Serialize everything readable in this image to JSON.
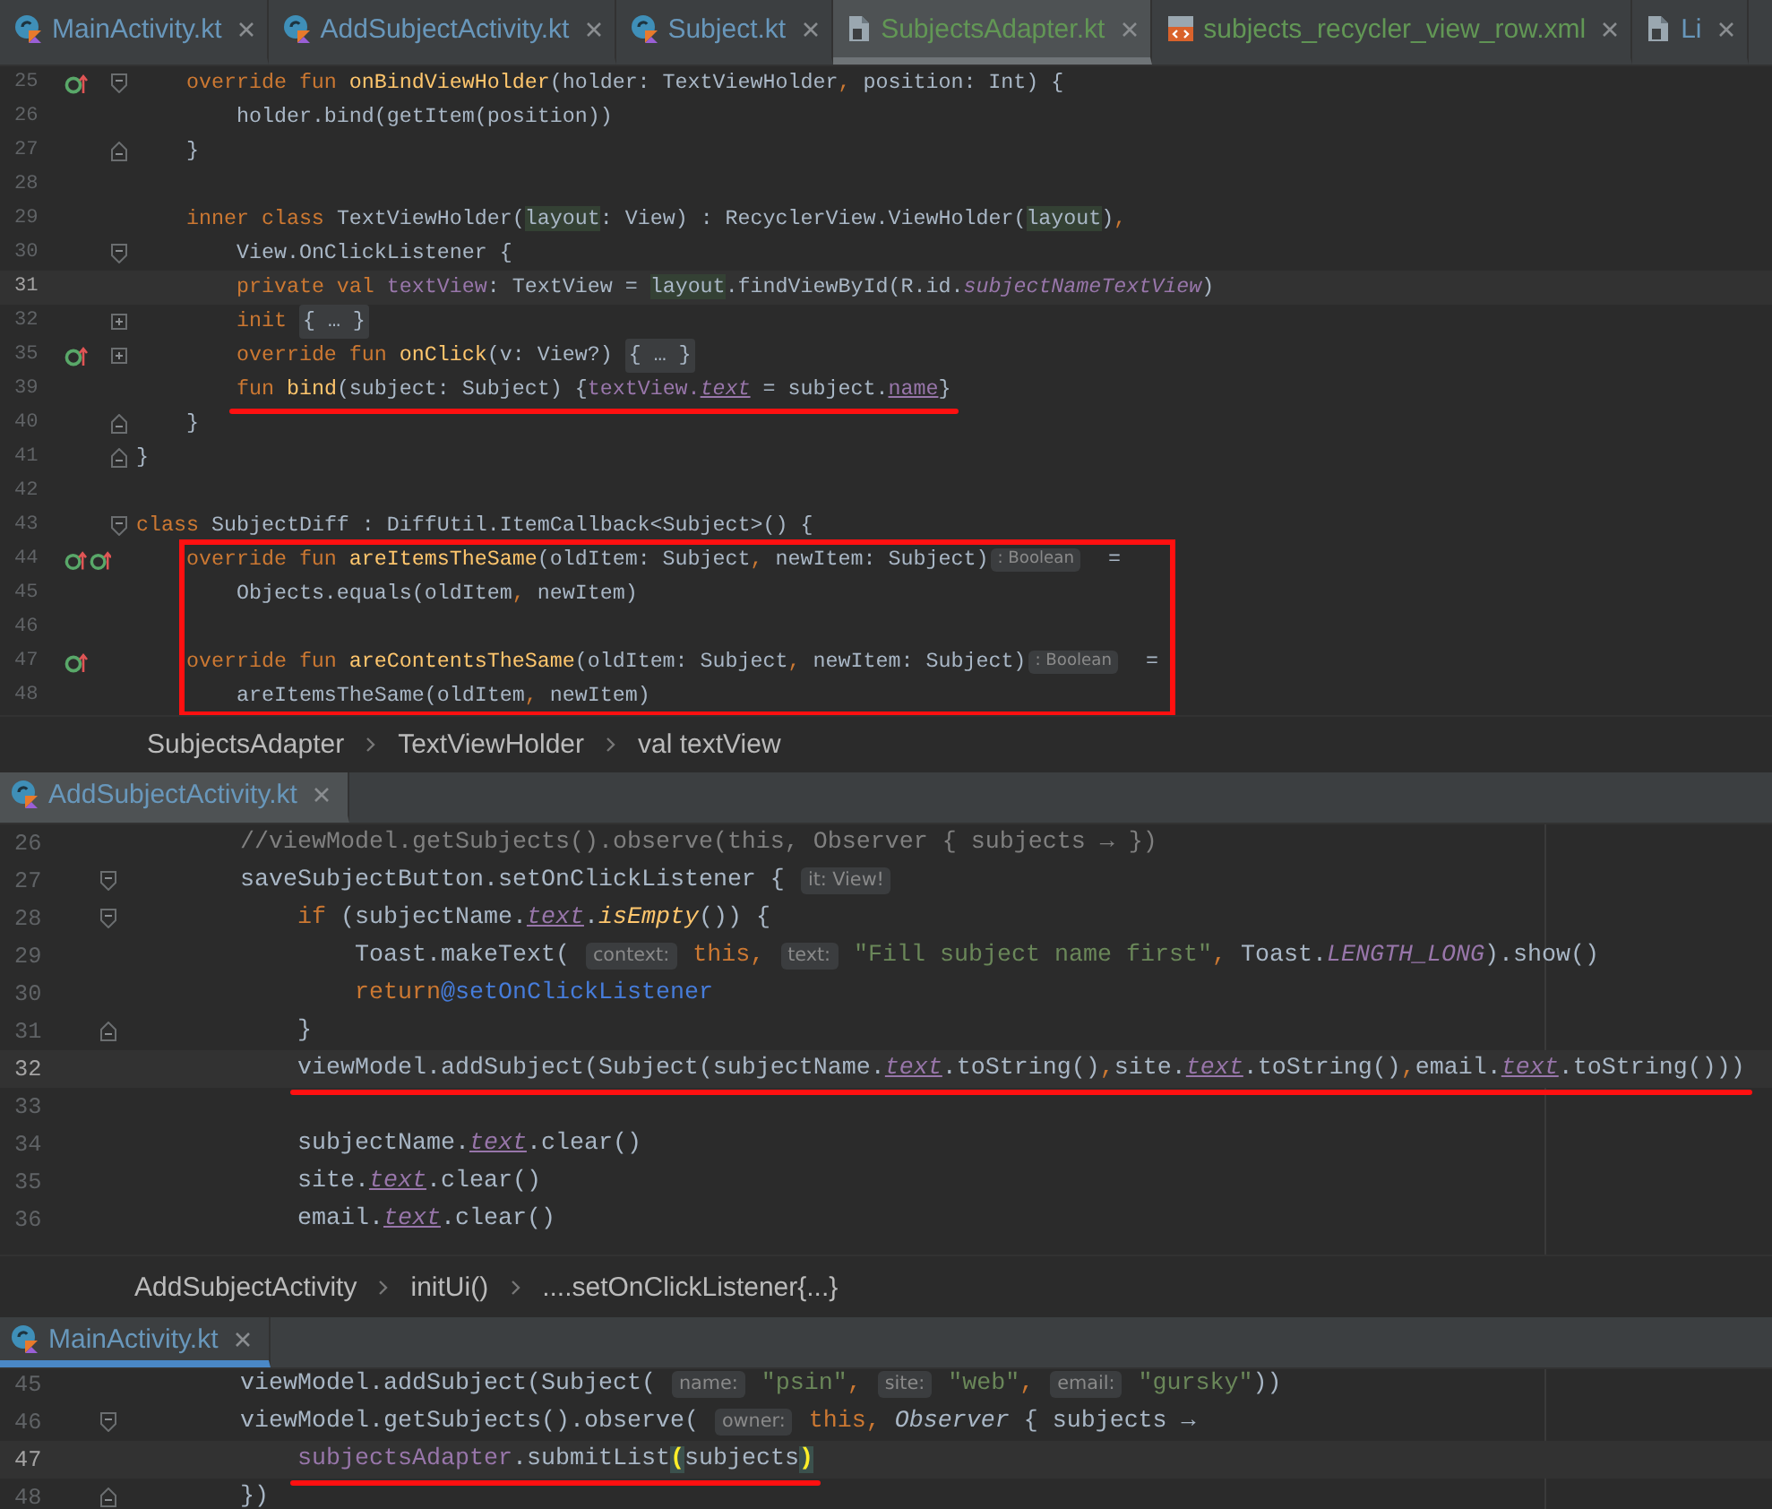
{
  "panels": [
    {
      "focused": false,
      "tabs": [
        {
          "label": "MainActivity.kt",
          "kind": "class",
          "color": "#6897bb",
          "selected": false
        },
        {
          "label": "AddSubjectActivity.kt",
          "kind": "class",
          "color": "#6897bb",
          "selected": false
        },
        {
          "label": "Subject.kt",
          "kind": "class",
          "color": "#6897bb",
          "selected": false
        },
        {
          "label": "SubjectsAdapter.kt",
          "kind": "file",
          "color": "#629755",
          "selected": true
        },
        {
          "label": "subjects_recycler_view_row.xml",
          "kind": "xml",
          "color": "#629755",
          "selected": false
        },
        {
          "label": "Li",
          "kind": "file",
          "color": "#6897bb",
          "selected": false
        }
      ],
      "lines": [
        {
          "number": "25",
          "gutter": [
            {
              "kind": "override"
            }
          ],
          "fold": {
            "kind": "start"
          },
          "current": false,
          "tokens": [
            {
              "text": "    override fun ",
              "kind": "kw"
            },
            {
              "text": "onBindViewHolder",
              "kind": "fn"
            },
            {
              "text": "(holder: TextViewHolder",
              "kind": "p"
            },
            {
              "text": ", ",
              "kind": "kw"
            },
            {
              "text": "position: Int) {",
              "kind": "p"
            }
          ]
        },
        {
          "number": "26",
          "current": false,
          "tokens": [
            {
              "text": "        holder.bind(getItem(position))",
              "kind": "p"
            }
          ]
        },
        {
          "number": "27",
          "fold": {
            "kind": "end"
          },
          "current": false,
          "tokens": [
            {
              "text": "    }",
              "kind": "p"
            }
          ]
        },
        {
          "number": "28",
          "current": false
        },
        {
          "number": "29",
          "current": false,
          "tokens": [
            {
              "text": "    inner class ",
              "kind": "kw"
            },
            {
              "text": "TextViewHolder(",
              "kind": "p"
            },
            {
              "text": "layout",
              "kind": "usage"
            },
            {
              "text": ": View) : RecyclerView.ViewHolder(",
              "kind": "p"
            },
            {
              "text": "layout",
              "kind": "usage"
            },
            {
              "text": ")",
              "kind": "p"
            },
            {
              "text": ",",
              "kind": "kw"
            }
          ]
        },
        {
          "number": "30",
          "fold": {
            "kind": "start"
          },
          "current": false,
          "tokens": [
            {
              "text": "        View.OnClickListener {",
              "kind": "p"
            }
          ]
        },
        {
          "number": "31",
          "current": true,
          "tokens": [
            {
              "text": "        private val ",
              "kind": "kw"
            },
            {
              "text": "textView",
              "kind": "prop"
            },
            {
              "text": ": TextView = ",
              "kind": "p"
            },
            {
              "text": "layout",
              "kind": "usage"
            },
            {
              "text": ".findViewById(R.id.",
              "kind": "p"
            },
            {
              "text": "subjectNameTextView",
              "kind": "prop-i"
            },
            {
              "text": ")",
              "kind": "p"
            }
          ]
        },
        {
          "number": "32",
          "fold": {
            "kind": "collapsed"
          },
          "current": false,
          "tokens": [
            {
              "text": "        init ",
              "kind": "kw"
            },
            {
              "text": "{ … }",
              "kind": "fold"
            }
          ]
        },
        {
          "number": "35",
          "gutter": [
            {
              "kind": "override"
            }
          ],
          "fold": {
            "kind": "collapsed"
          },
          "current": false,
          "tokens": [
            {
              "text": "        override fun ",
              "kind": "kw"
            },
            {
              "text": "onClick",
              "kind": "fn"
            },
            {
              "text": "(v: View?) ",
              "kind": "p"
            },
            {
              "text": "{ … }",
              "kind": "fold"
            }
          ]
        },
        {
          "number": "39",
          "current": false,
          "underlined": true,
          "tokens": [
            {
              "text": "        fun ",
              "kind": "kw"
            },
            {
              "text": "bind",
              "kind": "fn"
            },
            {
              "text": "(subject: Subject) {",
              "kind": "p"
            },
            {
              "text": "textView.",
              "kind": "prop"
            },
            {
              "text": "text",
              "kind": "prop-iu"
            },
            {
              "text": " = subject.",
              "kind": "p"
            },
            {
              "text": "name",
              "kind": "prop-u"
            },
            {
              "text": "}",
              "kind": "p"
            }
          ]
        },
        {
          "number": "40",
          "fold": {
            "kind": "end"
          },
          "current": false,
          "tokens": [
            {
              "text": "    }",
              "kind": "p"
            }
          ]
        },
        {
          "number": "41",
          "fold": {
            "kind": "end"
          },
          "current": false,
          "tokens": [
            {
              "text": "}",
              "kind": "p"
            }
          ]
        },
        {
          "number": "42",
          "current": false
        },
        {
          "number": "43",
          "fold": {
            "kind": "start"
          },
          "current": false,
          "tokens": [
            {
              "text": "class ",
              "kind": "kw"
            },
            {
              "text": "SubjectDiff : DiffUtil.ItemCallback<Subject>() {",
              "kind": "p"
            }
          ]
        },
        {
          "number": "44",
          "gutter": [
            {
              "kind": "override"
            },
            {
              "kind": "override"
            }
          ],
          "current": false,
          "boxed": true,
          "tokens": [
            {
              "text": "    override fun ",
              "kind": "kw"
            },
            {
              "text": "areItemsTheSame",
              "kind": "fn"
            },
            {
              "text": "(oldItem: Subject",
              "kind": "p"
            },
            {
              "text": ", ",
              "kind": "kw"
            },
            {
              "text": "newItem: Subject)",
              "kind": "p"
            },
            {
              "text": ": Boolean",
              "kind": "hint"
            },
            {
              "text": "  =",
              "kind": "p"
            }
          ]
        },
        {
          "number": "45",
          "current": false,
          "boxed": true,
          "tokens": [
            {
              "text": "        Objects.equals(oldItem",
              "kind": "p"
            },
            {
              "text": ", ",
              "kind": "kw"
            },
            {
              "text": "newItem)",
              "kind": "p"
            }
          ]
        },
        {
          "number": "46",
          "current": false,
          "boxed": true
        },
        {
          "number": "47",
          "gutter": [
            {
              "kind": "override"
            }
          ],
          "current": false,
          "boxed": true,
          "tokens": [
            {
              "text": "    override fun ",
              "kind": "kw"
            },
            {
              "text": "areContentsTheSame",
              "kind": "fn"
            },
            {
              "text": "(oldItem: Subject",
              "kind": "p"
            },
            {
              "text": ", ",
              "kind": "kw"
            },
            {
              "text": "newItem: Subject)",
              "kind": "p"
            },
            {
              "text": ": Boolean",
              "kind": "hint"
            },
            {
              "text": "  =",
              "kind": "p"
            }
          ]
        },
        {
          "number": "48",
          "current": false,
          "boxed": true,
          "tokens": [
            {
              "text": "        areItemsTheSame(oldItem",
              "kind": "p"
            },
            {
              "text": ", ",
              "kind": "kw"
            },
            {
              "text": "newItem)",
              "kind": "p"
            }
          ]
        }
      ],
      "breadcrumbs": [
        "SubjectsAdapter",
        "TextViewHolder",
        "val textView"
      ]
    },
    {
      "focused": false,
      "tabs": [
        {
          "label": "AddSubjectActivity.kt",
          "kind": "class",
          "color": "#6897bb",
          "selected": true
        }
      ],
      "lines": [
        {
          "number": "26",
          "current": false,
          "tokens": [
            {
              "text": "        //viewModel.getSubjects().observe(this, Observer { subjects → })",
              "kind": "com"
            }
          ]
        },
        {
          "number": "27",
          "fold": {
            "kind": "start"
          },
          "current": false,
          "tokens": [
            {
              "text": "        saveSubjectButton.setOnClickListener { ",
              "kind": "p"
            },
            {
              "text": "it: View!",
              "kind": "hint"
            }
          ]
        },
        {
          "number": "28",
          "fold": {
            "kind": "start"
          },
          "current": false,
          "tokens": [
            {
              "text": "            if ",
              "kind": "kw"
            },
            {
              "text": "(subjectName.",
              "kind": "p"
            },
            {
              "text": "text",
              "kind": "prop-iu"
            },
            {
              "text": ".",
              "kind": "p"
            },
            {
              "text": "isEmpty",
              "kind": "fn-i"
            },
            {
              "text": "()) {",
              "kind": "p"
            }
          ]
        },
        {
          "number": "29",
          "current": false,
          "tokens": [
            {
              "text": "                Toast.makeText( ",
              "kind": "p"
            },
            {
              "text": "context:",
              "kind": "hint"
            },
            {
              "text": " this, ",
              "kind": "kw"
            },
            {
              "text": "text:",
              "kind": "hint"
            },
            {
              "text": " \"Fill subject name first\"",
              "kind": "str"
            },
            {
              "text": ", ",
              "kind": "kw"
            },
            {
              "text": "Toast.",
              "kind": "p"
            },
            {
              "text": "LENGTH_LONG",
              "kind": "prop-i"
            },
            {
              "text": ").show()",
              "kind": "p"
            }
          ]
        },
        {
          "number": "30",
          "current": false,
          "tokens": [
            {
              "text": "                return",
              "kind": "kw"
            },
            {
              "text": "@setOnClickListener",
              "kind": "label"
            }
          ]
        },
        {
          "number": "31",
          "fold": {
            "kind": "end"
          },
          "current": false,
          "tokens": [
            {
              "text": "            }",
              "kind": "p"
            }
          ]
        },
        {
          "number": "32",
          "current": true,
          "underlined": true,
          "tokens": [
            {
              "text": "            viewModel.addSubject(Subject(subjectName.",
              "kind": "p"
            },
            {
              "text": "text",
              "kind": "prop-iu"
            },
            {
              "text": ".toString()",
              "kind": "p"
            },
            {
              "text": ",",
              "kind": "kw"
            },
            {
              "text": "site.",
              "kind": "p"
            },
            {
              "text": "text",
              "kind": "prop-iu"
            },
            {
              "text": ".toString()",
              "kind": "p"
            },
            {
              "text": ",",
              "kind": "kw"
            },
            {
              "text": "email.",
              "kind": "p"
            },
            {
              "text": "text",
              "kind": "prop-iu"
            },
            {
              "text": ".toString()))",
              "kind": "p"
            }
          ]
        },
        {
          "number": "33",
          "current": false
        },
        {
          "number": "34",
          "current": false,
          "tokens": [
            {
              "text": "            subjectName.",
              "kind": "p"
            },
            {
              "text": "text",
              "kind": "prop-iu"
            },
            {
              "text": ".clear()",
              "kind": "p"
            }
          ]
        },
        {
          "number": "35",
          "current": false,
          "tokens": [
            {
              "text": "            site.",
              "kind": "p"
            },
            {
              "text": "text",
              "kind": "prop-iu"
            },
            {
              "text": ".clear()",
              "kind": "p"
            }
          ]
        },
        {
          "number": "36",
          "current": false,
          "tokens": [
            {
              "text": "            email.",
              "kind": "p"
            },
            {
              "text": "text",
              "kind": "prop-iu"
            },
            {
              "text": ".clear()",
              "kind": "p"
            }
          ]
        }
      ],
      "breadcrumbs": [
        "AddSubjectActivity",
        "initUi()",
        "....setOnClickListener{...}"
      ]
    },
    {
      "focused": true,
      "tabs": [
        {
          "label": "MainActivity.kt",
          "kind": "class",
          "color": "#6897bb",
          "selected": true
        }
      ],
      "lines": [
        {
          "number": "45",
          "current": false,
          "tokens": [
            {
              "text": "        viewModel.addSubject(Subject( ",
              "kind": "p"
            },
            {
              "text": "name:",
              "kind": "hint"
            },
            {
              "text": " \"psin\"",
              "kind": "str"
            },
            {
              "text": ", ",
              "kind": "kw"
            },
            {
              "text": "site:",
              "kind": "hint"
            },
            {
              "text": " \"web\"",
              "kind": "str"
            },
            {
              "text": ", ",
              "kind": "kw"
            },
            {
              "text": "email:",
              "kind": "hint"
            },
            {
              "text": " \"gursky\"",
              "kind": "str"
            },
            {
              "text": "))",
              "kind": "p"
            }
          ]
        },
        {
          "number": "46",
          "fold": {
            "kind": "start"
          },
          "current": false,
          "tokens": [
            {
              "text": "        viewModel.getSubjects().observe( ",
              "kind": "p"
            },
            {
              "text": "owner:",
              "kind": "hint"
            },
            {
              "text": " this, ",
              "kind": "kw"
            },
            {
              "text": "Observer",
              "kind": "italic"
            },
            {
              "text": " { subjects →",
              "kind": "p"
            }
          ]
        },
        {
          "number": "47",
          "current": true,
          "underlined": true,
          "tokens": [
            {
              "text": "            subjectsAdapter",
              "kind": "prop"
            },
            {
              "text": ".submitList",
              "kind": "p"
            },
            {
              "text": "(",
              "kind": "match"
            },
            {
              "text": "subjects",
              "kind": "p"
            },
            {
              "text": ")",
              "kind": "match"
            }
          ]
        },
        {
          "number": "48",
          "fold": {
            "kind": "end"
          },
          "current": false,
          "tokens": [
            {
              "text": "        })",
              "kind": "p"
            }
          ]
        }
      ]
    }
  ]
}
